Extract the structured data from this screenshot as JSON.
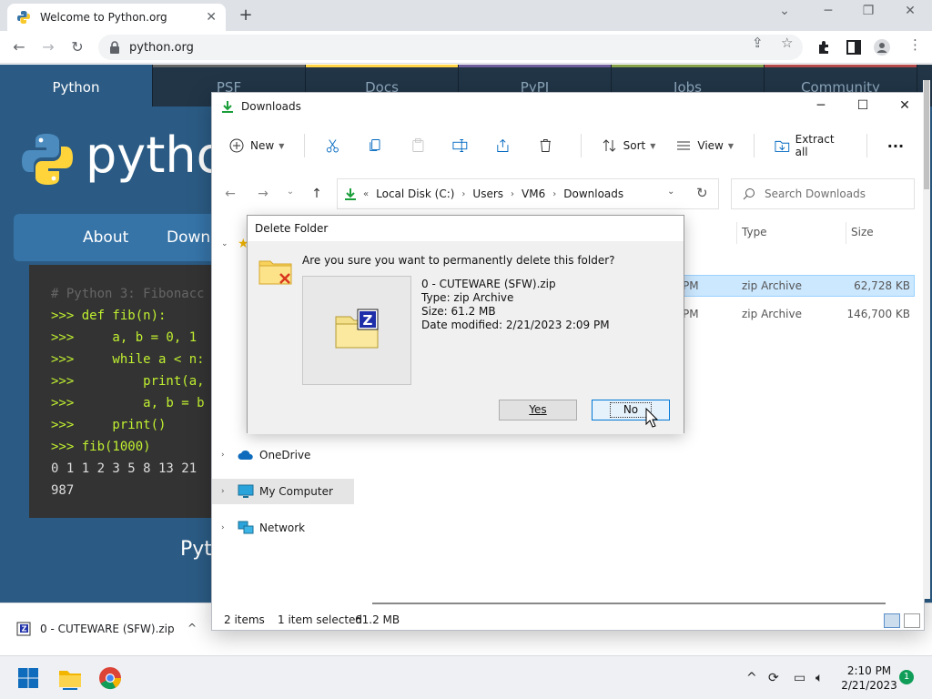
{
  "browser": {
    "tab_title": "Welcome to Python.org",
    "tab_close": "✕",
    "new_tab": "+",
    "url": "python.org"
  },
  "python_site": {
    "top_nav": [
      "Python",
      "PSF",
      "Docs",
      "PyPI",
      "Jobs",
      "Community"
    ],
    "logo_text": "python",
    "main_nav": [
      "About",
      "Downl"
    ],
    "code_lines": [
      {
        "cls": "code-comment",
        "text": "# Python 3: Fibonacc"
      },
      {
        "cls": "code-prompt",
        "text": ">>> def fib(n):"
      },
      {
        "cls": "code-prompt",
        "text": ">>>     a, b = 0, 1"
      },
      {
        "cls": "code-prompt",
        "text": ">>>     while a < n:"
      },
      {
        "cls": "code-prompt",
        "text": ">>>         print(a,"
      },
      {
        "cls": "code-prompt",
        "text": ">>>         a, b = b"
      },
      {
        "cls": "code-prompt",
        "text": ">>>     print()"
      },
      {
        "cls": "code-prompt",
        "text": ">>> fib(1000)"
      },
      {
        "cls": "code-out",
        "text": "0 1 1 2 3 5 8 13 21"
      },
      {
        "cls": "code-out",
        "text": "987"
      }
    ],
    "bottom_text": "Pyt"
  },
  "download_bar": {
    "file_name": "0 - CUTEWARE (SFW).zip",
    "chevron": "^"
  },
  "explorer": {
    "title": "Downloads",
    "commands": {
      "new": "New",
      "sort": "Sort",
      "view": "View",
      "extract_all": "Extract all",
      "more": "···"
    },
    "address": {
      "prefix": "«",
      "crumbs": [
        "Local Disk (C:)",
        "Users",
        "VM6",
        "Downloads"
      ]
    },
    "search_placeholder": "Search Downloads",
    "nav": {
      "onedrive": "OneDrive",
      "my_computer": "My Computer",
      "network": "Network"
    },
    "columns": {
      "type": "Type",
      "size": "Size"
    },
    "files": [
      {
        "time": "PM",
        "type": "zip Archive",
        "size": "62,728 KB",
        "selected": true
      },
      {
        "time": "PM",
        "type": "zip Archive",
        "size": "146,700 KB",
        "selected": false
      }
    ],
    "status": {
      "items": "2 items",
      "selected": "1 item selected",
      "size": "61.2 MB"
    }
  },
  "dialog": {
    "title": "Delete Folder",
    "question": "Are you sure you want to permanently delete this folder?",
    "file_name": "0 - CUTEWARE (SFW).zip",
    "type": "Type: zip Archive",
    "size": "Size: 61.2 MB",
    "date_modified": "Date modified: 2/21/2023 2:09 PM",
    "yes": "Yes",
    "no": "No"
  },
  "taskbar": {
    "time": "2:10 PM",
    "date": "2/21/2023",
    "notifications": "1"
  },
  "colors": {
    "python_blue": "#2b5b84",
    "python_dark": "#213547",
    "selection": "#cce8ff",
    "accent": "#0078d7"
  }
}
